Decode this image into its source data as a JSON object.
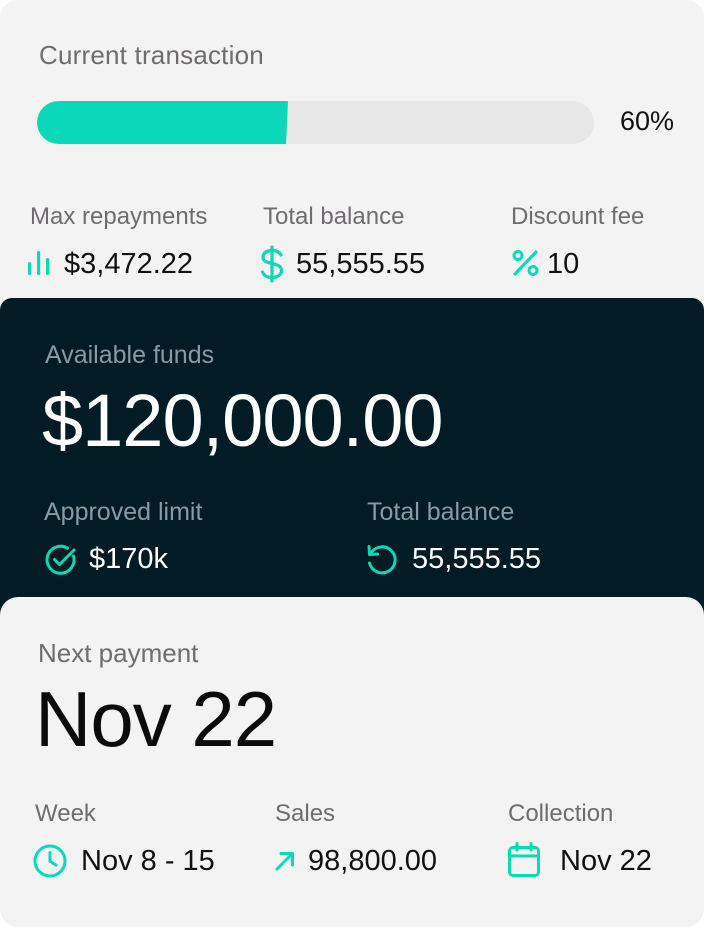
{
  "transaction": {
    "title": "Current transaction",
    "progress": 0.6,
    "progress_label": "60%"
  },
  "stats": {
    "max_repayments": {
      "label": "Max repayments",
      "value": "$3,472.22",
      "icon": "bar-chart-icon"
    },
    "total_balance": {
      "label": "Total balance",
      "value": "55,555.55",
      "icon": "dollar-icon"
    },
    "discount_fee": {
      "label": "Discount fee",
      "value": "10",
      "icon": "percent-icon"
    }
  },
  "funds": {
    "label": "Available funds",
    "amount": "$120,000.00",
    "approved_limit": {
      "label": "Approved limit",
      "value": "$170k",
      "icon": "check-circle-icon"
    },
    "total_balance": {
      "label": "Total balance",
      "value": "55,555.55",
      "icon": "refresh-icon"
    }
  },
  "payment": {
    "label": "Next payment",
    "date": "Nov 22",
    "week": {
      "label": "Week",
      "value": "Nov 8 - 15",
      "icon": "clock-icon"
    },
    "sales": {
      "label": "Sales",
      "value": "98,800.00",
      "icon": "arrow-up-right-icon"
    },
    "collection": {
      "label": "Collection",
      "value": "Nov 22",
      "icon": "calendar-icon"
    }
  },
  "colors": {
    "accent": "#0ad8b8",
    "dark_bg": "#031b25",
    "card_bg": "#f4f3f4"
  }
}
